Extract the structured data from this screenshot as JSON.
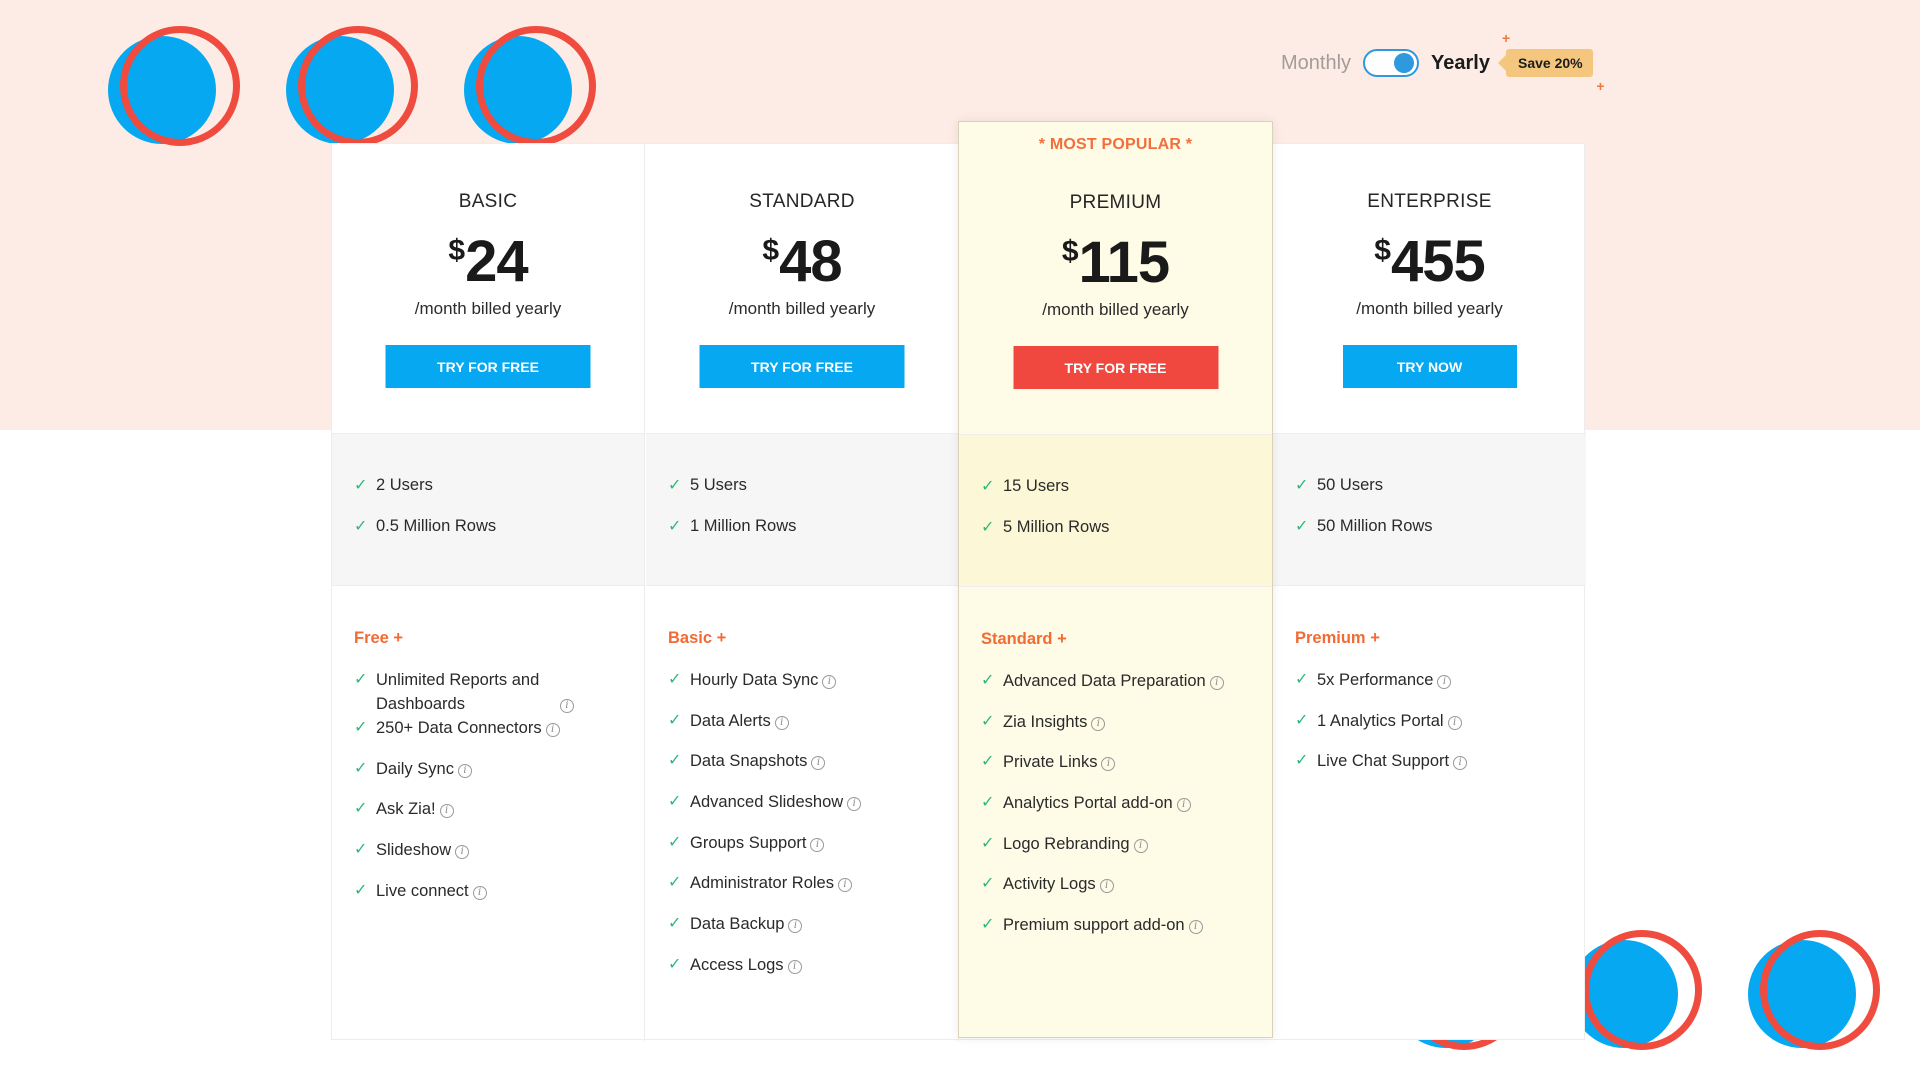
{
  "billing": {
    "monthly_label": "Monthly",
    "yearly_label": "Yearly",
    "toggle_state": "yearly",
    "save_badge": "Save 20%"
  },
  "colors": {
    "primary_blue": "#05a8f1",
    "highlight_red": "#f0483e",
    "accent_orange": "#f26b35",
    "check_green": "#2fb87a",
    "band_pink": "#fdebe5",
    "premium_bg": "#fefbe7"
  },
  "plans": [
    {
      "name": "BASIC",
      "currency": "$",
      "price": "24",
      "billing_note": "/month billed yearly",
      "cta": "TRY FOR FREE",
      "quota": [
        "2 Users",
        "0.5 Million Rows"
      ],
      "features_header": "Free +",
      "features": [
        "Unlimited Reports and Dashboards",
        "250+ Data Connectors",
        "Daily Sync",
        "Ask Zia!",
        "Slideshow",
        "Live connect"
      ]
    },
    {
      "name": "STANDARD",
      "currency": "$",
      "price": "48",
      "billing_note": "/month billed yearly",
      "cta": "TRY FOR FREE",
      "quota": [
        "5 Users",
        "1 Million Rows"
      ],
      "features_header": "Basic +",
      "features": [
        "Hourly Data Sync",
        "Data Alerts",
        "Data Snapshots",
        "Advanced Slideshow",
        "Groups Support",
        "Administrator Roles",
        "Data Backup",
        "Access Logs"
      ]
    },
    {
      "name": "PREMIUM",
      "badge": "* MOST POPULAR *",
      "currency": "$",
      "price": "115",
      "billing_note": "/month billed yearly",
      "cta": "TRY FOR FREE",
      "quota": [
        "15 Users",
        "5 Million Rows"
      ],
      "features_header": "Standard +",
      "features": [
        "Advanced Data Preparation",
        "Zia Insights",
        "Private Links",
        "Analytics Portal add-on",
        "Logo Rebranding",
        "Activity Logs",
        "Premium support add-on"
      ]
    },
    {
      "name": "ENTERPRISE",
      "currency": "$",
      "price": "455",
      "billing_note": "/month billed yearly",
      "cta": "TRY NOW",
      "quota": [
        "50 Users",
        "50 Million Rows"
      ],
      "features_header": "Premium +",
      "features": [
        "5x Performance",
        "1 Analytics Portal",
        "Live Chat Support"
      ]
    }
  ],
  "icons": {
    "check": "✓",
    "info": "i",
    "sparkle": "+"
  }
}
